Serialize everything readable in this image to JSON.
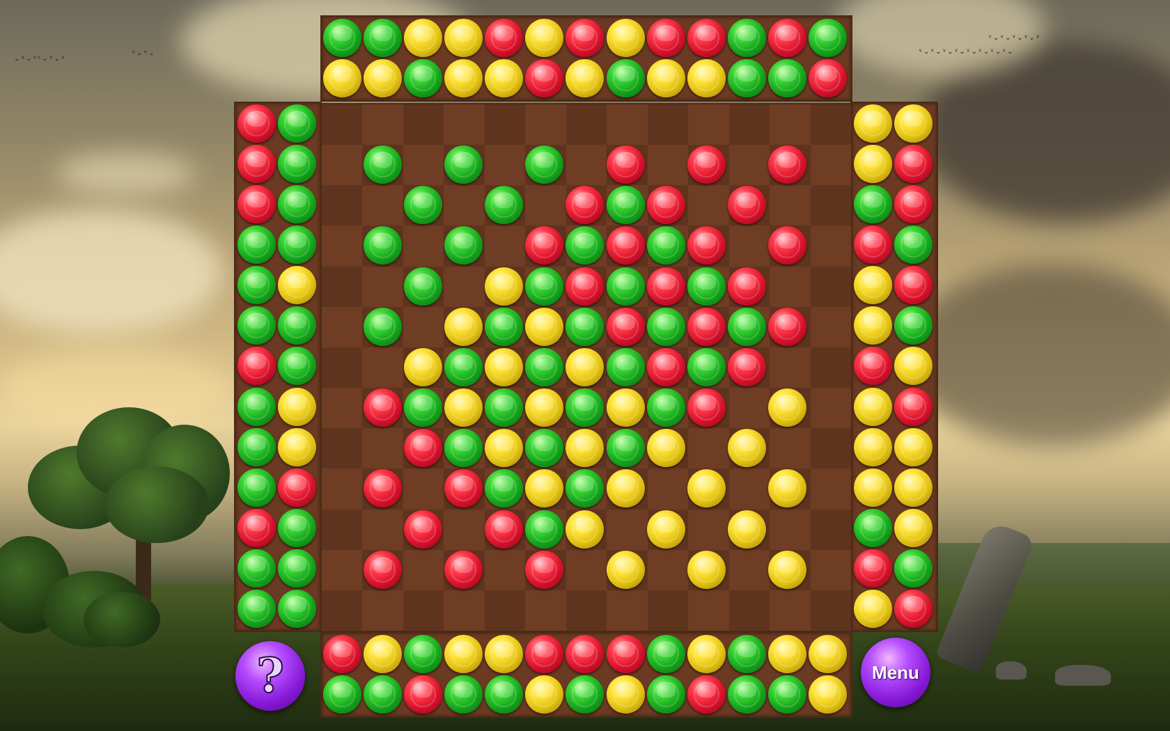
{
  "buttons": {
    "help_label": "?",
    "menu_label": "Menu"
  },
  "colors": {
    "green": "#1fb81f",
    "red": "#e01a32",
    "yellow": "#f0d020",
    "board": "#6f3d24",
    "button": "#9b2de8"
  },
  "top_rack": [
    [
      "green",
      "green",
      "yellow",
      "yellow",
      "red",
      "yellow",
      "red",
      "yellow",
      "red",
      "red",
      "green",
      "red",
      "green"
    ],
    [
      "yellow",
      "yellow",
      "green",
      "yellow",
      "yellow",
      "red",
      "yellow",
      "green",
      "yellow",
      "yellow",
      "green",
      "green",
      "red"
    ]
  ],
  "bottom_rack": [
    [
      "red",
      "yellow",
      "green",
      "yellow",
      "yellow",
      "red",
      "red",
      "red",
      "green",
      "yellow",
      "green",
      "yellow",
      "yellow"
    ],
    [
      "green",
      "green",
      "red",
      "green",
      "green",
      "yellow",
      "green",
      "yellow",
      "green",
      "red",
      "green",
      "green",
      "yellow"
    ]
  ],
  "left_rack": [
    [
      "red",
      "green"
    ],
    [
      "red",
      "green"
    ],
    [
      "red",
      "green"
    ],
    [
      "green",
      "green"
    ],
    [
      "green",
      "yellow"
    ],
    [
      "green",
      "green"
    ],
    [
      "red",
      "green"
    ],
    [
      "green",
      "yellow"
    ],
    [
      "green",
      "yellow"
    ],
    [
      "green",
      "red"
    ],
    [
      "red",
      "green"
    ],
    [
      "green",
      "green"
    ],
    [
      "green",
      "green"
    ]
  ],
  "right_rack": [
    [
      "yellow",
      "yellow"
    ],
    [
      "yellow",
      "red"
    ],
    [
      "green",
      "red"
    ],
    [
      "red",
      "green"
    ],
    [
      "yellow",
      "red"
    ],
    [
      "yellow",
      "green"
    ],
    [
      "red",
      "yellow"
    ],
    [
      "yellow",
      "red"
    ],
    [
      "yellow",
      "yellow"
    ],
    [
      "yellow",
      "yellow"
    ],
    [
      "green",
      "yellow"
    ],
    [
      "red",
      "green"
    ],
    [
      "yellow",
      "red"
    ]
  ],
  "board": [
    [
      null,
      null,
      null,
      null,
      null,
      null,
      null,
      null,
      null,
      null,
      null,
      null,
      null
    ],
    [
      null,
      "green",
      null,
      "green",
      null,
      "green",
      null,
      "red",
      null,
      "red",
      null,
      "red",
      null
    ],
    [
      null,
      null,
      "green",
      null,
      "green",
      null,
      "red",
      "green",
      "red",
      null,
      "red",
      null,
      null
    ],
    [
      null,
      "green",
      null,
      "green",
      null,
      "red",
      "green",
      "red",
      "green",
      "red",
      null,
      "red",
      null
    ],
    [
      null,
      null,
      "green",
      null,
      "yellow",
      "green",
      "red",
      "green",
      "red",
      "green",
      "red",
      null,
      null
    ],
    [
      null,
      "green",
      null,
      "yellow",
      "green",
      "yellow",
      "green",
      "red",
      "green",
      "red",
      "green",
      "red",
      null
    ],
    [
      null,
      null,
      "yellow",
      "green",
      "yellow",
      "green",
      "yellow",
      "green",
      "red",
      "green",
      "red",
      null,
      null
    ],
    [
      null,
      "red",
      "green",
      "yellow",
      "green",
      "yellow",
      "green",
      "yellow",
      "green",
      "red",
      null,
      "yellow",
      null
    ],
    [
      null,
      null,
      "red",
      "green",
      "yellow",
      "green",
      "yellow",
      "green",
      "yellow",
      null,
      "yellow",
      null,
      null
    ],
    [
      null,
      "red",
      null,
      "red",
      "green",
      "yellow",
      "green",
      "yellow",
      null,
      "yellow",
      null,
      "yellow",
      null
    ],
    [
      null,
      null,
      "red",
      null,
      "red",
      "green",
      "yellow",
      null,
      "yellow",
      null,
      "yellow",
      null,
      null
    ],
    [
      null,
      "red",
      null,
      "red",
      null,
      "red",
      null,
      "yellow",
      null,
      "yellow",
      null,
      "yellow",
      null
    ],
    [
      null,
      null,
      null,
      null,
      null,
      null,
      null,
      null,
      null,
      null,
      null,
      null,
      null
    ]
  ]
}
